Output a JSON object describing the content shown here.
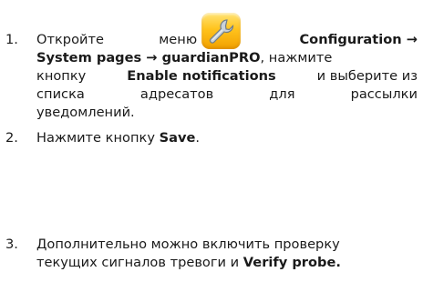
{
  "steps": [
    {
      "number": "1.",
      "lines": [
        [
          "Откройте",
          "меню",
          "Configuration →"
        ],
        [
          "System pages → guardianPRO",
          ", нажмите"
        ],
        [
          "кнопку",
          "Enable notifications",
          "и выберите из"
        ],
        [
          "списка",
          "адресатов",
          "для",
          "рассылки"
        ],
        [
          "уведомлений."
        ]
      ]
    },
    {
      "number": "2.",
      "text_before": "Нажмите кнопку",
      "bold": "Save",
      "text_after": "."
    },
    {
      "number": "3.",
      "line1": "Дополнительно можно включить проверку",
      "line2_text": "текущих сигналов тревоги и",
      "line2_bold": "Verify probe."
    }
  ],
  "icon": "wrench-tool-icon"
}
